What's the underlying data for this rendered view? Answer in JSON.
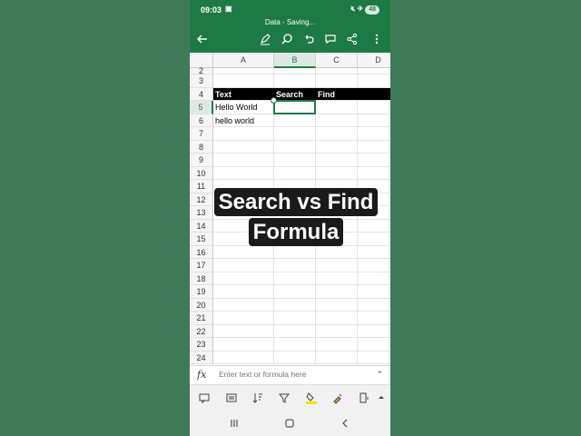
{
  "status": {
    "time": "09:03",
    "battery": "48"
  },
  "app": {
    "doc_title": "Data - Saving..."
  },
  "sheet": {
    "columns": [
      "A",
      "B",
      "C",
      "D"
    ],
    "selected_column": "B",
    "rows": [
      "2",
      "3",
      "4",
      "5",
      "6",
      "7",
      "8",
      "9",
      "10",
      "11",
      "12",
      "13",
      "14",
      "15",
      "16",
      "17",
      "18",
      "19",
      "20",
      "21",
      "22",
      "23",
      "24"
    ],
    "selected_row": "5",
    "cells": {
      "A4": "Text",
      "B4": "Search",
      "C4": "Find",
      "A5": "Hello World",
      "A6": "hello world"
    }
  },
  "overlay": {
    "line1": "Search vs Find",
    "line2": "Formula"
  },
  "formula_bar": {
    "fx": "fx",
    "placeholder": "Enter text or formula here"
  },
  "colors": {
    "brand": "#1d7a45",
    "background": "#3f7a58",
    "header_fill": "#000000"
  },
  "icons": {
    "appbar": [
      "back-icon",
      "draw-icon",
      "search-icon",
      "undo-icon",
      "comment-icon",
      "share-icon",
      "more-icon"
    ],
    "toolbar": [
      "comment-icon",
      "card-view-icon",
      "sort-icon",
      "filter-icon",
      "fill-color-icon",
      "format-painter-icon",
      "insert-column-icon",
      "expand-icon"
    ],
    "nav": [
      "recents-icon",
      "home-icon",
      "back-icon"
    ]
  }
}
